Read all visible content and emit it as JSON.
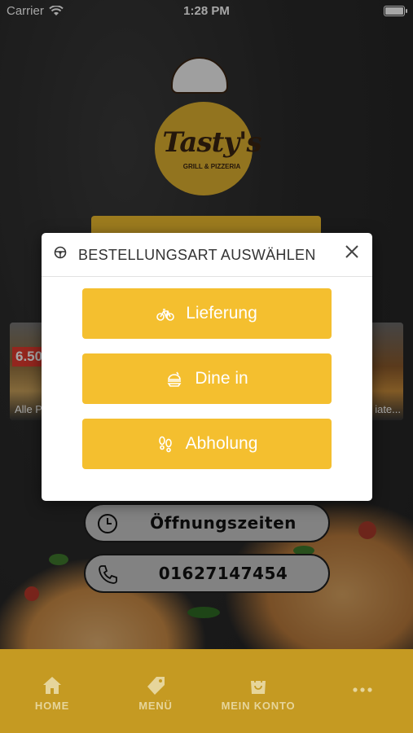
{
  "status_bar": {
    "carrier": "Carrier",
    "time": "1:28 PM"
  },
  "logo": {
    "title": "Tasty's",
    "subtitle": "GRILL & PIZZERIA"
  },
  "background_cards": {
    "left": {
      "price": "6.50",
      "caption": "Alle Pi"
    },
    "right": {
      "caption": "iate..."
    }
  },
  "modal": {
    "title": "BESTELLUNGSART AUSWÄHLEN",
    "options": [
      {
        "label": "Lieferung",
        "icon": "bicycle-icon"
      },
      {
        "label": "Dine in",
        "icon": "food-icon"
      },
      {
        "label": "Abholung",
        "icon": "footsteps-icon"
      }
    ]
  },
  "info": {
    "hours_label": "Öffnungszeiten",
    "phone": "01627147454"
  },
  "tabs": [
    {
      "label": "HOME",
      "icon": "home-icon"
    },
    {
      "label": "MENÜ",
      "icon": "tag-icon"
    },
    {
      "label": "MEIN KONTO",
      "icon": "shopping-bag-icon"
    },
    {
      "label": "",
      "icon": "more-icon"
    }
  ],
  "colors": {
    "accent": "#f4bf2f",
    "tab_bar": "#c59a22",
    "logo": "#e0b330"
  }
}
